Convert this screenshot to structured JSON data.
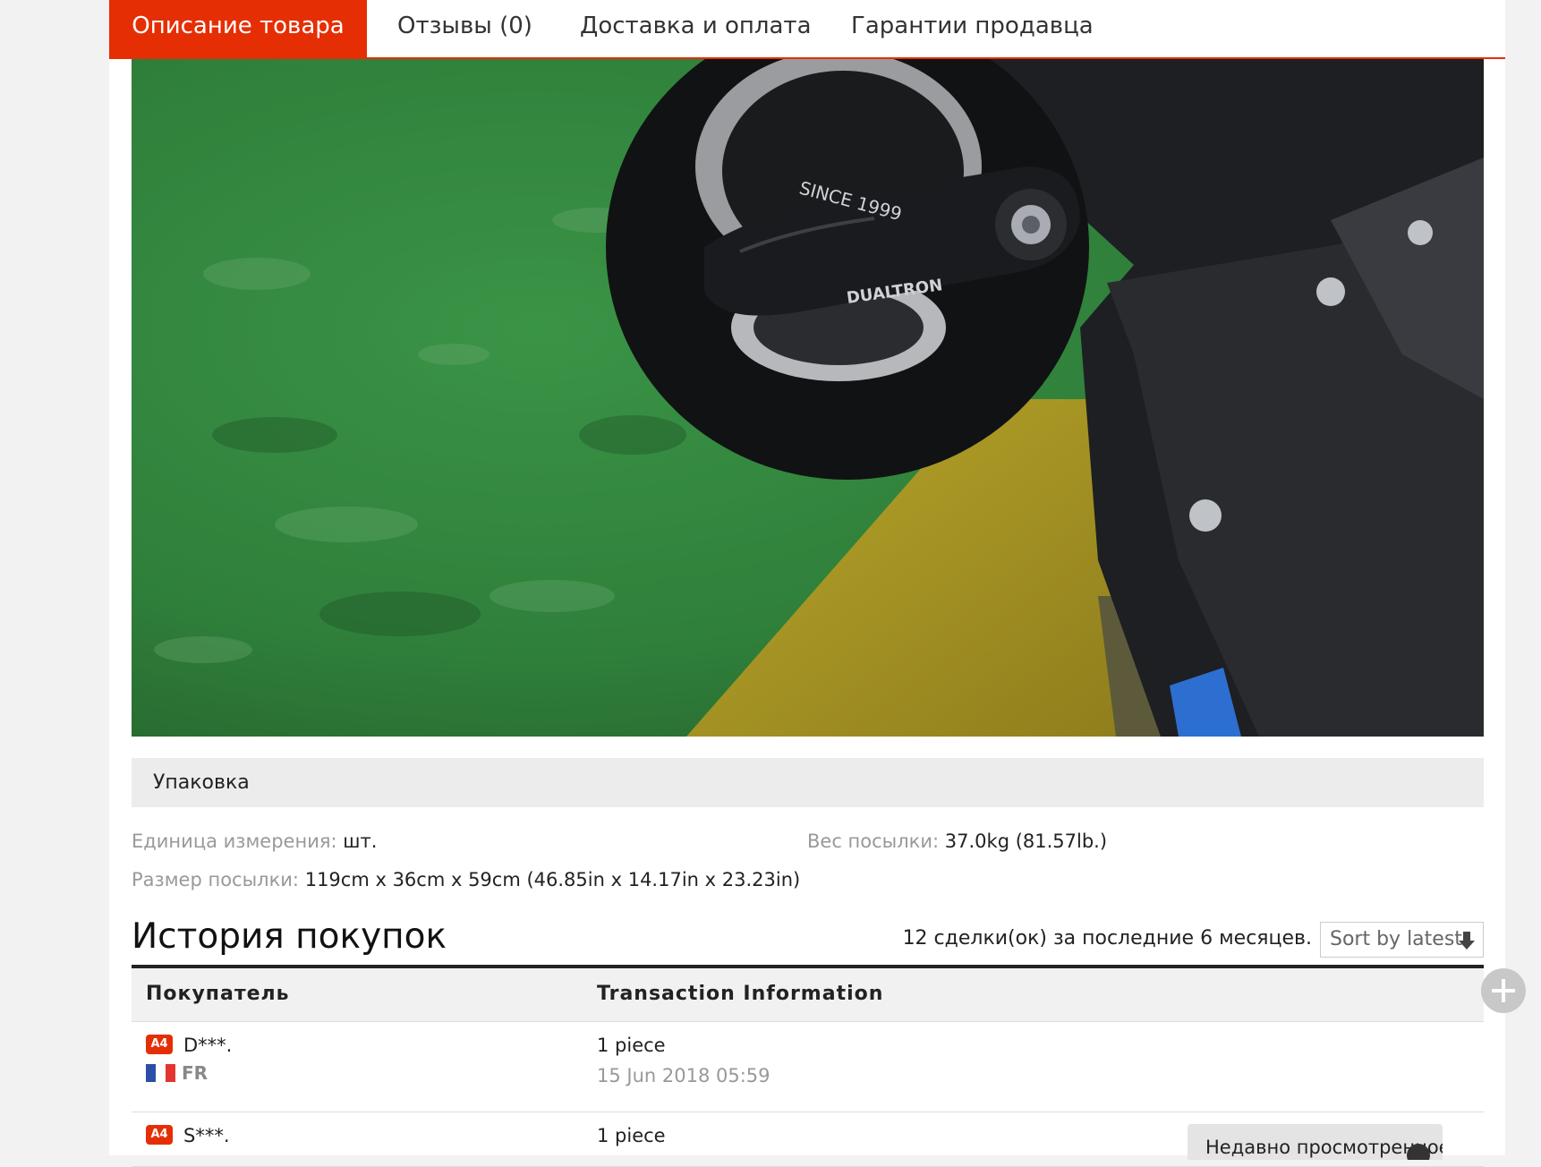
{
  "tabs": [
    {
      "label": "Описание товара",
      "active": true
    },
    {
      "label": "Отзывы (0)"
    },
    {
      "label": "Доставка и оплата"
    },
    {
      "label": "Гарантии продавца"
    }
  ],
  "photo": {
    "brand_mark": "DUALTRON",
    "rim_text": "SINCE 1999"
  },
  "packaging": {
    "title": "Упаковка",
    "unit_label": "Единица измерения:",
    "unit_value": "шт.",
    "weight_label": "Вес посылки:",
    "weight_value": "37.0kg (81.57lb.)",
    "size_label": "Размер посылки:",
    "size_value": "119cm x 36cm x 59cm (46.85in x 14.17in x 23.23in)"
  },
  "history": {
    "title": "История покупок",
    "count_text": "12 сделки(ок) за последние 6 месяцев.",
    "sort_label": "Sort by latest",
    "columns": [
      "Покупатель",
      "Transaction Information"
    ],
    "rows": [
      {
        "badge": "A4",
        "buyer": "D***.",
        "country": "FR",
        "quantity": "1 piece",
        "date": "15 Jun 2018 05:59"
      },
      {
        "badge": "A4",
        "buyer": "S***.",
        "quantity": "1 piece"
      }
    ]
  },
  "widgets": {
    "recent_label": "Недавно просмотренное"
  },
  "colors": {
    "accent": "#e62e04",
    "flag_fr": [
      "#2b4fa8",
      "#ffffff",
      "#e3352f"
    ]
  }
}
